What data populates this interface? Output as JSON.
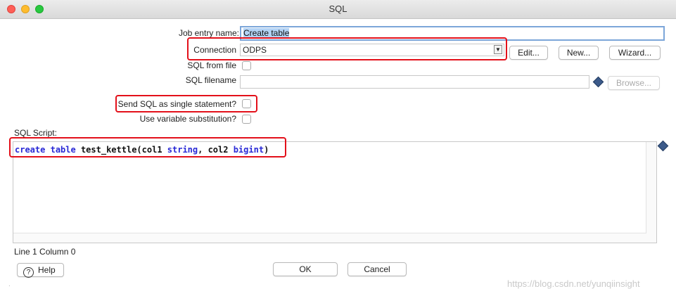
{
  "window": {
    "title": "SQL"
  },
  "form": {
    "job_entry_name_label": "Job entry name:",
    "job_entry_name_value": "Create table",
    "connection_label": "Connection",
    "connection_value": "ODPS",
    "sql_from_file_label": "SQL from file",
    "sql_filename_label": "SQL filename",
    "sql_filename_value": "",
    "single_statement_label": "Send SQL as single statement?",
    "variable_substitution_label": "Use variable substitution?",
    "sql_script_label": "SQL Script:"
  },
  "buttons": {
    "edit": "Edit...",
    "new": "New...",
    "wizard": "Wizard...",
    "browse": "Browse...",
    "help": "Help",
    "ok": "OK",
    "cancel": "Cancel"
  },
  "editor": {
    "tokens": [
      "create",
      " ",
      "table",
      " test_kettle(col1 ",
      "string",
      ", col2 ",
      "bigint",
      ")"
    ],
    "status": "Line 1 Column 0"
  },
  "checkboxes": {
    "sql_from_file": false,
    "single_statement": false,
    "variable_substitution": false
  },
  "watermark": "https://blog.csdn.net/yunqiinsight",
  "colors": {
    "keyword": "#2929d6",
    "highlight_box": "#e3101a",
    "focus_border": "#7ca6d9"
  },
  "icons": {
    "help": "question-circle-icon",
    "variable": "dollar-diamond-icon",
    "dropdown": "chevron-down-icon"
  }
}
